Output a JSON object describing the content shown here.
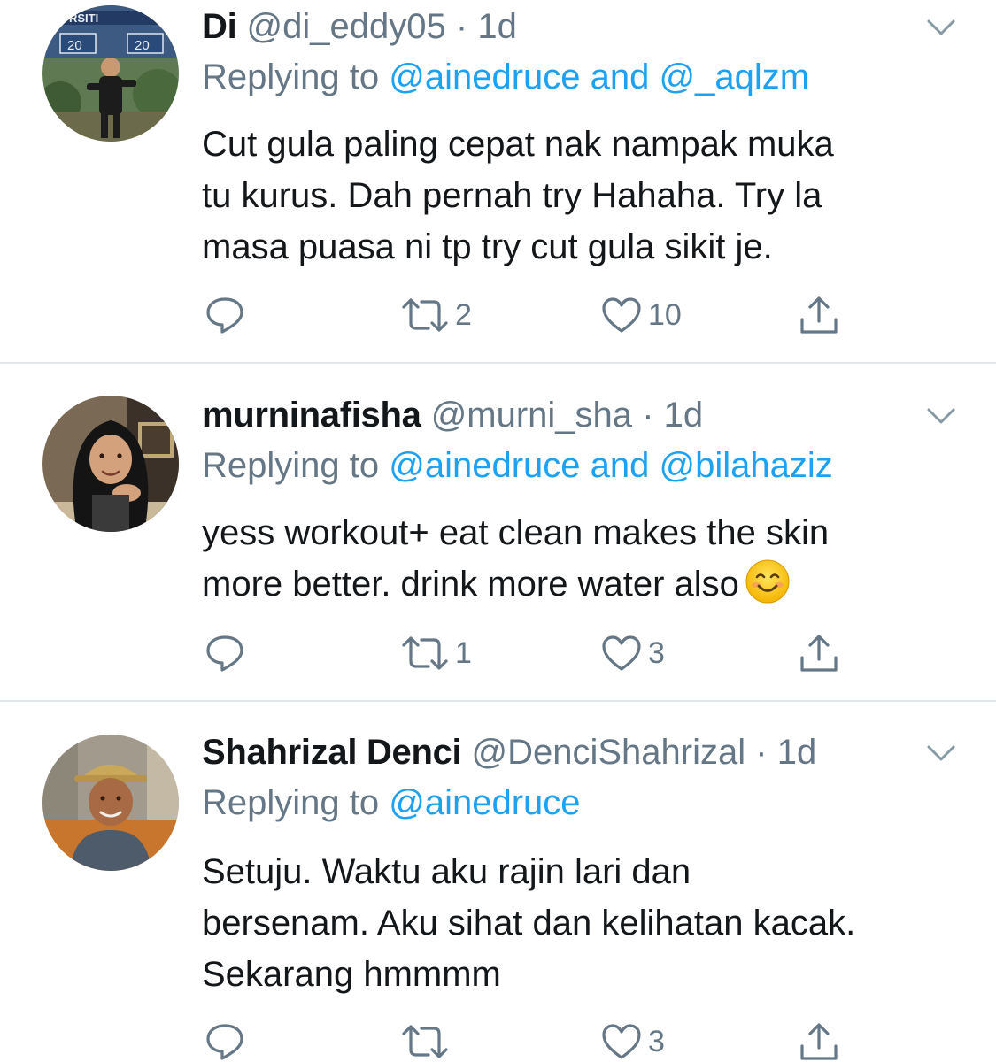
{
  "tweets": [
    {
      "name": "Di",
      "handle": "@di_eddy05",
      "dot": "·",
      "time": "1d",
      "reply_prefix": "Replying to",
      "reply_mentions": "@ainedruce and @_aqlzm",
      "body_lines": [
        "Cut gula paling cepat nak nampak muka",
        "tu kurus. Dah pernah try Hahaha. Try la",
        "masa puasa ni tp try cut gula sikit je."
      ],
      "retweets": "2",
      "likes": "10"
    },
    {
      "name": "murninafisha",
      "handle": "@murni_sha",
      "dot": "·",
      "time": "1d",
      "reply_prefix": "Replying to",
      "reply_mentions": "@ainedruce and @bilahaziz",
      "body_lines": [
        "yess workout+ eat clean makes the skin",
        "more better. drink more water also"
      ],
      "emoji": "smiling-face-emoji",
      "retweets": "1",
      "likes": "3"
    },
    {
      "name": "Shahrizal Denci",
      "handle": "@DenciShahrizal",
      "dot": "·",
      "time": "1d",
      "reply_prefix": "Replying to",
      "reply_mentions": "@ainedruce",
      "body_lines": [
        "Setuju. Waktu aku rajin lari dan",
        "bersenam. Aku sihat dan kelihatan kacak.",
        "Sekarang hmmmm"
      ],
      "retweets": "",
      "likes": "3"
    }
  ],
  "avatar_1_text": {
    "banner": "RSITI",
    "year_left": "20",
    "year_right": "20"
  },
  "icons": {
    "reply": "reply-icon",
    "retweet": "retweet-icon",
    "like": "heart-icon",
    "share": "share-icon",
    "menu": "chevron-down-icon"
  },
  "colors": {
    "name": "#14171a",
    "secondary": "#657786",
    "mention": "#1da1f2",
    "divider": "#e1e8ed",
    "icon": "#657786"
  }
}
